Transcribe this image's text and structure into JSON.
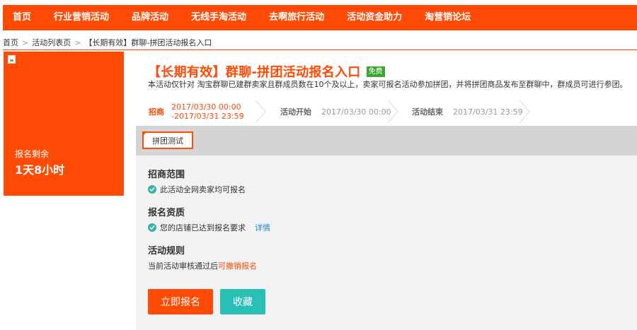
{
  "nav": [
    "首页",
    "行业营销活动",
    "品牌活动",
    "无线手淘活动",
    "去啊旅行活动",
    "活动资金助力",
    "淘营销论坛"
  ],
  "breadcrumb": {
    "home": "首页",
    "sep": ">",
    "list": "活动列表页",
    "current": "【长期有效】群聊-拼团活动报名入口"
  },
  "left_card": {
    "remain_label": "报名剩余",
    "remain_value": "1天8小时"
  },
  "activity": {
    "title": "【长期有效】群聊-拼团活动报名入口",
    "badge": "免费",
    "description": "本活动仅针对 淘宝群聊已建群卖家且群成员数在10个及以上，卖家可报名活动参加拼团，并将拼团商品发布至群聊中，群成员可进行参团。"
  },
  "timeline": {
    "recruit": {
      "label": "招商",
      "start": "2017/03/30 00:00",
      "end": "-2017/03/31 23:59"
    },
    "start": {
      "label": "活动开始",
      "value": "2017/03/30 00:00"
    },
    "end": {
      "label": "活动结束",
      "value": "2017/03/31 23:59"
    }
  },
  "tab": {
    "label": "拼团测试"
  },
  "sections": {
    "scope": {
      "title": "招商范围",
      "text": "此活动全网卖家均可报名"
    },
    "qualification": {
      "title": "报名资质",
      "text": "您的店铺已达到报名要求",
      "link": "详情"
    },
    "rules": {
      "title": "活动规则",
      "text": "当前活动审核通过后",
      "highlight": "可撤销报名"
    }
  },
  "buttons": {
    "signup": "立即报名",
    "favorite": "收藏"
  },
  "colors": {
    "brand": "#ff4b05",
    "free_badge": "#3aa82f",
    "check": "#36b3a8",
    "favorite": "#29bfb4",
    "link": "#1b8ad1"
  }
}
